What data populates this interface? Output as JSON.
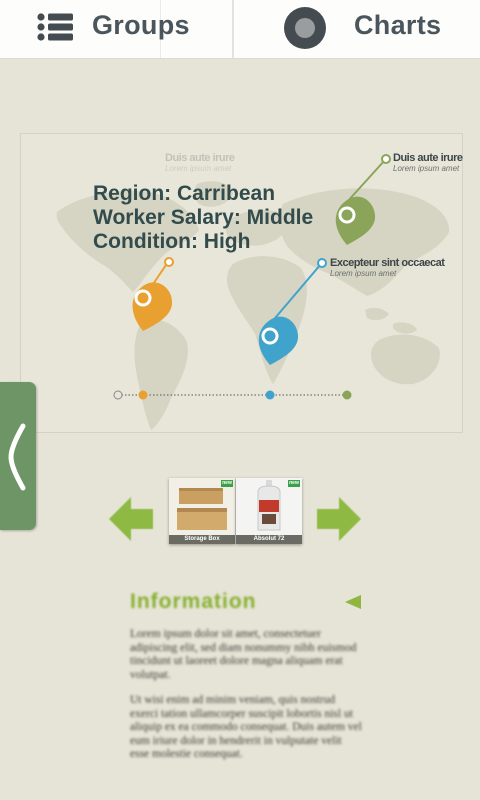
{
  "tabs": {
    "groups": {
      "label": "Groups",
      "icon": "list-icon"
    },
    "charts": {
      "label": "Charts",
      "icon": "record-icon"
    }
  },
  "map": {
    "info": {
      "region": "Region: Carribean",
      "salary": "Worker Salary: Middle",
      "condition": "Condition: High"
    },
    "pins": [
      {
        "title": "Duis aute irure",
        "subtitle": "Lorem ipsum amet",
        "color": "#8aa55a"
      },
      {
        "title": "Excepteur sint occaecat",
        "subtitle": "Lorem ipsum amet",
        "color": "#3fa3cc"
      },
      {
        "title": "Duis aute irure",
        "subtitle": "Lorem ipsum amet",
        "color": "#e8a030"
      }
    ]
  },
  "carousel": {
    "items": [
      {
        "caption": "Storage Box",
        "badge": "new"
      },
      {
        "caption": "Absolut 72",
        "badge": "new"
      }
    ]
  },
  "information": {
    "heading": "Information",
    "paragraphs": [
      "Lorem ipsum dolor sit amet, consectetuer adipiscing elit, sed diam nonummy nibh euismod tincidunt ut laoreet dolore magna aliquam erat volutpat.",
      "Ut wisi enim ad minim veniam, quis nostrud exerci tation ullamcorper suscipit lobortis nisl ut aliquip ex ea commodo consequat. Duis autem vel eum iriure dolor in hendrerit in vulputate velit esse molestie consequat."
    ]
  },
  "colors": {
    "accent_green": "#86b02f",
    "handle_green": "#6e9565",
    "text_dark": "#324b4c"
  }
}
